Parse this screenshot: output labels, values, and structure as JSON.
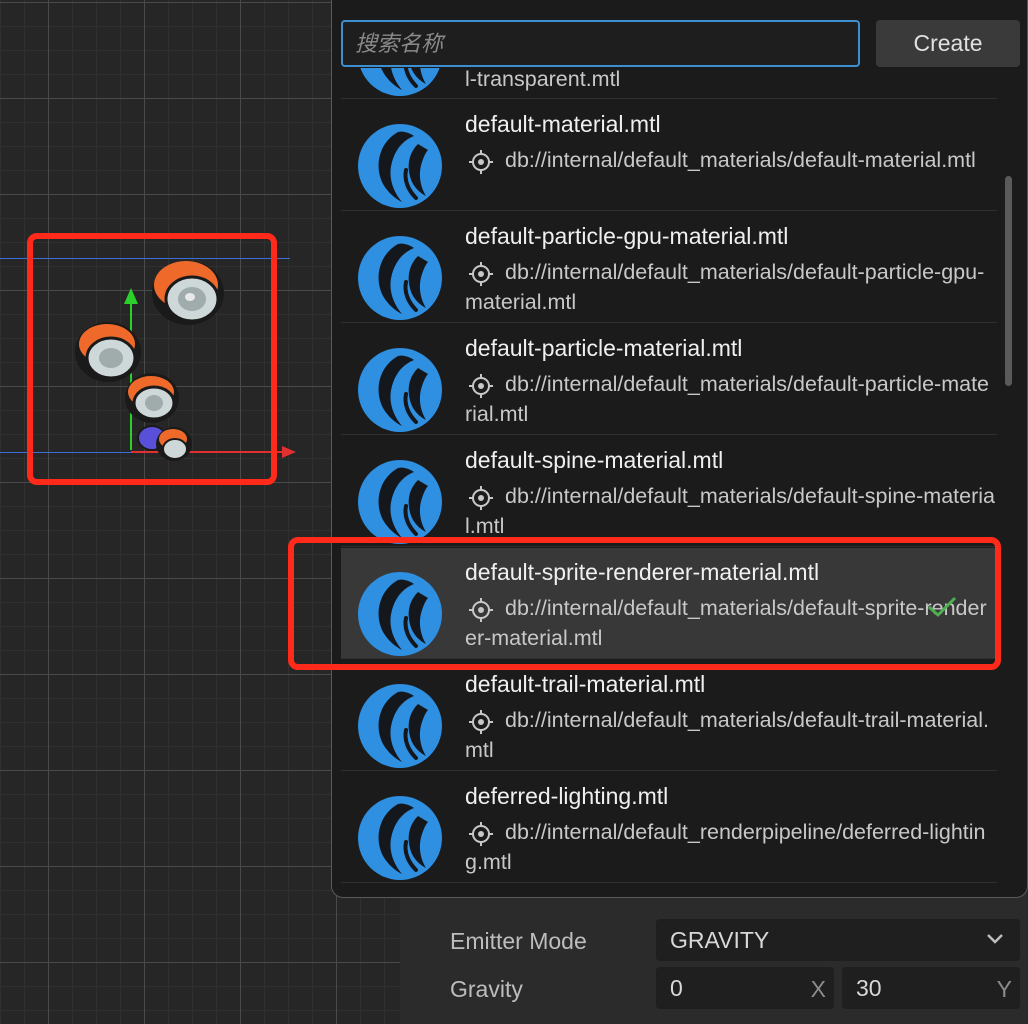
{
  "scene": {
    "highlight_color": "#ff2a1a"
  },
  "inspector": {
    "emitter_mode_label": "Emitter Mode",
    "emitter_mode_value": "GRAVITY",
    "gravity_label": "Gravity",
    "gravity_x": "0",
    "gravity_y": "30",
    "axis_x": "X",
    "axis_y": "Y"
  },
  "popup": {
    "search_placeholder": "搜索名称",
    "create_label": "Create",
    "items": [
      {
        "name": "",
        "path": "l-transparent.mtl",
        "partial": true
      },
      {
        "name": "default-material.mtl",
        "path": "db://internal/default_materials/default-material.mtl"
      },
      {
        "name": "default-particle-gpu-material.mtl",
        "path": "db://internal/default_materials/default-particle-gpu-material.mtl"
      },
      {
        "name": "default-particle-material.mtl",
        "path": "db://internal/default_materials/default-particle-material.mtl"
      },
      {
        "name": "default-spine-material.mtl",
        "path": "db://internal/default_materials/default-spine-material.mtl"
      },
      {
        "name": "default-sprite-renderer-material.mtl",
        "path": "db://internal/default_materials/default-sprite-renderer-material.mtl",
        "selected": true
      },
      {
        "name": "default-trail-material.mtl",
        "path": "db://internal/default_materials/default-trail-material.mtl"
      },
      {
        "name": "deferred-lighting.mtl",
        "path": "db://internal/default_renderpipeline/deferred-lighting.mtl"
      }
    ],
    "accent_color": "#3d8fd0",
    "logo_color": "#2f8fe0",
    "check_color": "#4caf50"
  }
}
